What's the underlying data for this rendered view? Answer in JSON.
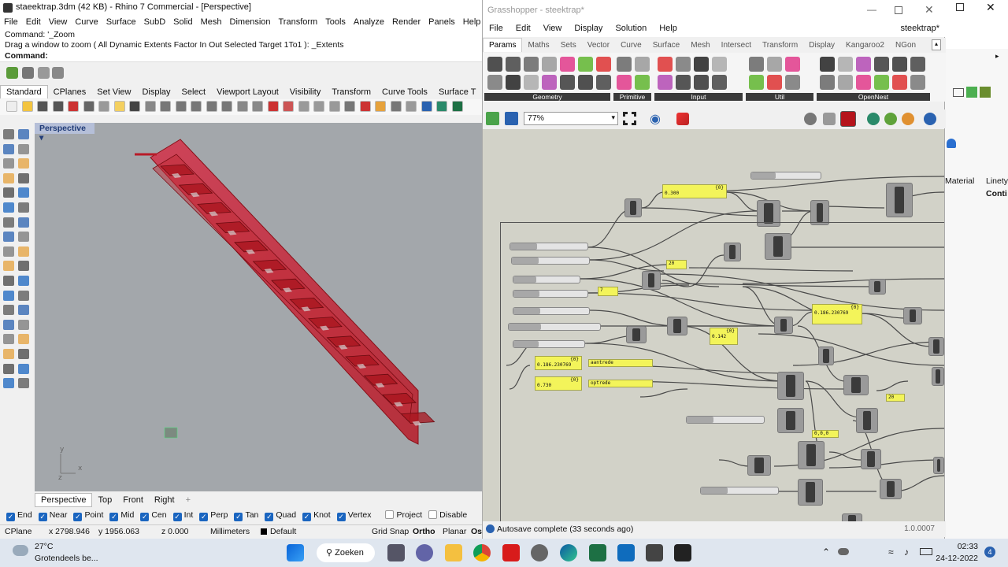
{
  "rhino": {
    "title": "staeektrap.3dm (42 KB) - Rhino 7 Commercial - [Perspective]",
    "menus": [
      "File",
      "Edit",
      "View",
      "Curve",
      "Surface",
      "SubD",
      "Solid",
      "Mesh",
      "Dimension",
      "Transform",
      "Tools",
      "Analyze",
      "Render",
      "Panels",
      "Help"
    ],
    "command_history": [
      "Command: '_Zoom",
      "Drag a window to zoom ( All  Dynamic  Extents  Factor  In  Out  Selected  Target  1To1 ): _Extents"
    ],
    "command_prompt": "Command:",
    "toolbar_tabs": [
      "Standard",
      "CPlanes",
      "Set View",
      "Display",
      "Select",
      "Viewport Layout",
      "Visibility",
      "Transform",
      "Curve Tools",
      "Surface T"
    ],
    "viewport_label": "Perspective",
    "viewport_tabs": [
      "Perspective",
      "Top",
      "Front",
      "Right"
    ],
    "osnaps": [
      {
        "label": "End",
        "on": true
      },
      {
        "label": "Near",
        "on": true
      },
      {
        "label": "Point",
        "on": true
      },
      {
        "label": "Mid",
        "on": true
      },
      {
        "label": "Cen",
        "on": true
      },
      {
        "label": "Int",
        "on": true
      },
      {
        "label": "Perp",
        "on": true
      },
      {
        "label": "Tan",
        "on": true
      },
      {
        "label": "Quad",
        "on": true
      },
      {
        "label": "Knot",
        "on": true
      },
      {
        "label": "Vertex",
        "on": true
      },
      {
        "label": "Project",
        "on": false
      },
      {
        "label": "Disable",
        "on": false
      }
    ],
    "status": {
      "cplane": "CPlane",
      "x": "x 2798.946",
      "y": "y 1956.063",
      "z": "z 0.000",
      "units": "Millimeters",
      "layer": "Default",
      "grid_snap": "Grid Snap",
      "ortho": "Ortho",
      "planar": "Planar",
      "osnap_short": "Os"
    },
    "right_panel": {
      "material": "Material",
      "linetype": "Linety",
      "conti": "Conti"
    }
  },
  "gh": {
    "title": "Grasshopper - steektrap*",
    "menus": [
      "File",
      "Edit",
      "View",
      "Display",
      "Solution",
      "Help"
    ],
    "document": "steektrap*",
    "tabs": [
      "Params",
      "Maths",
      "Sets",
      "Vector",
      "Curve",
      "Surface",
      "Mesh",
      "Intersect",
      "Transform",
      "Display",
      "Kangaroo2",
      "NGon"
    ],
    "groups": [
      "Geometry",
      "Primitive",
      "Input",
      "Util",
      "OpenNest"
    ],
    "zoom": "77%",
    "status": "Autosave complete (33 seconds ago)",
    "version": "1.0.0007",
    "panels": [
      {
        "header": "{0}",
        "value": "0.300"
      },
      {
        "header": "",
        "value": "20"
      },
      {
        "header": "",
        "value": "7"
      },
      {
        "header": "{0}",
        "value": "0.186.230769"
      },
      {
        "header": "{0}",
        "value": "0.142"
      },
      {
        "header": "{0}",
        "value": "0.186.230769"
      },
      {
        "header": "{0}",
        "value": "0.730"
      },
      {
        "header": "",
        "value": "aantrede"
      },
      {
        "header": "",
        "value": "optrede"
      },
      {
        "header": "",
        "value": "20"
      },
      {
        "header": "",
        "value": "0,0,0"
      }
    ],
    "big_panel": {
      "header": "{0}",
      "value": "0.186.230769"
    }
  },
  "taskbar": {
    "temperature": "27°C",
    "weather": "Grotendeels be...",
    "search": "Zoeken",
    "time": "02:33",
    "date": "24-12-2022",
    "notifications": "4"
  },
  "colors": {
    "stair": "#c8202c",
    "viewport_bg": "#a3a7ab",
    "canvas_bg": "#d2d2c8",
    "panel_yellow": "#f3f45a",
    "accent": "#1a65c0"
  }
}
